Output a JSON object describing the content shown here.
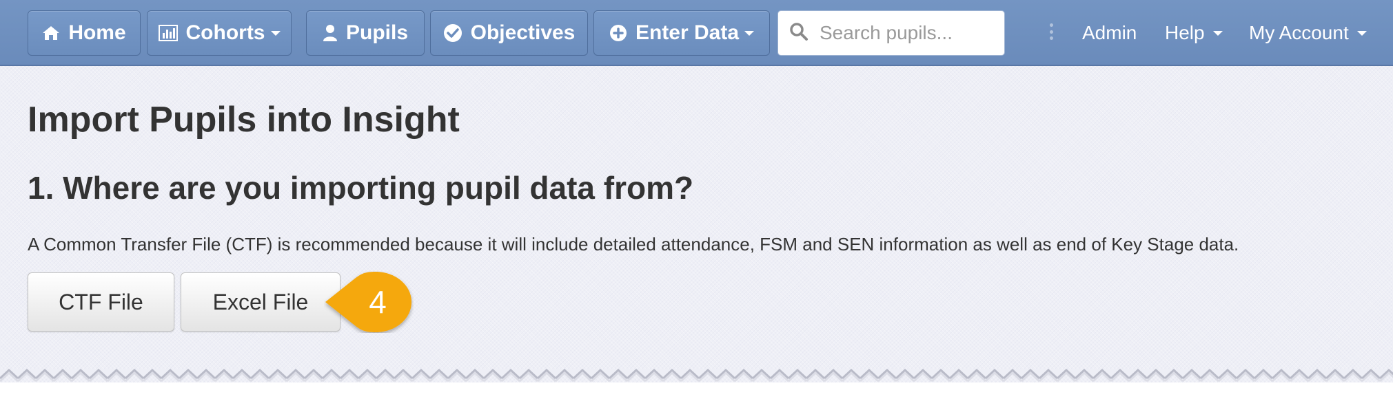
{
  "navbar": {
    "home_label": "Home",
    "cohorts_label": "Cohorts",
    "pupils_label": "Pupils",
    "objectives_label": "Objectives",
    "enter_data_label": "Enter Data",
    "search_placeholder": "Search pupils...",
    "admin_label": "Admin",
    "help_label": "Help",
    "account_label": "My Account",
    "icons": [
      "home-icon",
      "bar-chart-icon",
      "user-icon",
      "check-circle-icon",
      "plus-circle-icon",
      "search-icon",
      "chevron-down-icon"
    ]
  },
  "page": {
    "title": "Import Pupils into Insight",
    "step_title": "1. Where are you importing pupil data from?",
    "description": "A Common Transfer File (CTF) is recommended because it will include detailed attendance, FSM and SEN information as well as end of Key Stage data.",
    "buttons": {
      "ctf": "CTF File",
      "excel": "Excel File"
    },
    "callout_number": "4"
  },
  "colors": {
    "navbar": "#6a8bbb",
    "content_bg": "#eeeff6",
    "callout": "#f5a80c",
    "text": "#333333"
  }
}
